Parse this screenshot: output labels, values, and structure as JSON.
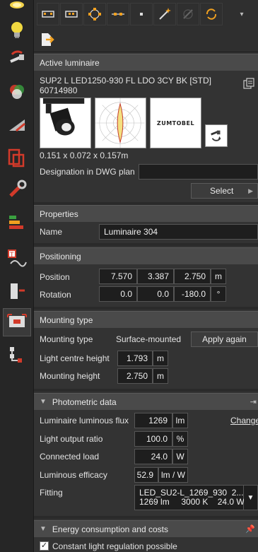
{
  "top_toolbar": {
    "dropdown_icon": "chevron-down-icon"
  },
  "active_luminaire": {
    "header": "Active luminaire",
    "name": "SUP2 L LED1250-930 FL LDO 3CY BK [STD]",
    "code": "60714980",
    "dimensions": "0.151 x 0.072 x 0.157m",
    "brand": "ZUMTOBEL",
    "designation_label": "Designation in DWG plan",
    "designation_value": "",
    "select_label": "Select"
  },
  "properties": {
    "header": "Properties",
    "name_label": "Name",
    "name_value": "Luminaire 304"
  },
  "positioning": {
    "header": "Positioning",
    "position_label": "Position",
    "position": [
      "7.570",
      "3.387",
      "2.750"
    ],
    "position_unit": "m",
    "rotation_label": "Rotation",
    "rotation": [
      "0.0",
      "0.0",
      "-180.0"
    ],
    "rotation_unit": "°"
  },
  "mounting": {
    "header": "Mounting type",
    "type_label": "Mounting type",
    "type_value": "Surface-mounted",
    "apply_label": "Apply again",
    "light_centre_label": "Light centre height",
    "light_centre_value": "1.793",
    "mounting_height_label": "Mounting height",
    "mounting_height_value": "2.750",
    "unit": "m"
  },
  "photometric": {
    "header": "Photometric data",
    "change_label": "Change",
    "flux_label": "Luminaire luminous flux",
    "flux_value": "1269",
    "flux_unit": "lm",
    "lor_label": "Light output ratio",
    "lor_value": "100.0",
    "lor_unit": "%",
    "load_label": "Connected load",
    "load_value": "24.0",
    "load_unit": "W",
    "efficacy_label": "Luminous efficacy",
    "efficacy_value": "52.9",
    "efficacy_unit": "lm / W",
    "fitting_label": "Fitting",
    "fitting_line1": "LED_SU2-L_1269_930  2...",
    "fitting_line2": "1269 lm     3000 K    24.0 W"
  },
  "energy": {
    "header": "Energy consumption and costs",
    "constant_label": "Constant light regulation possible",
    "constant_checked": true
  },
  "colors": {
    "panel_bg": "#333333",
    "header_bg": "#4a4a4a",
    "field_bg": "#1e1e1e",
    "accent_red": "#d23a2a",
    "accent_orange": "#f0a020"
  }
}
